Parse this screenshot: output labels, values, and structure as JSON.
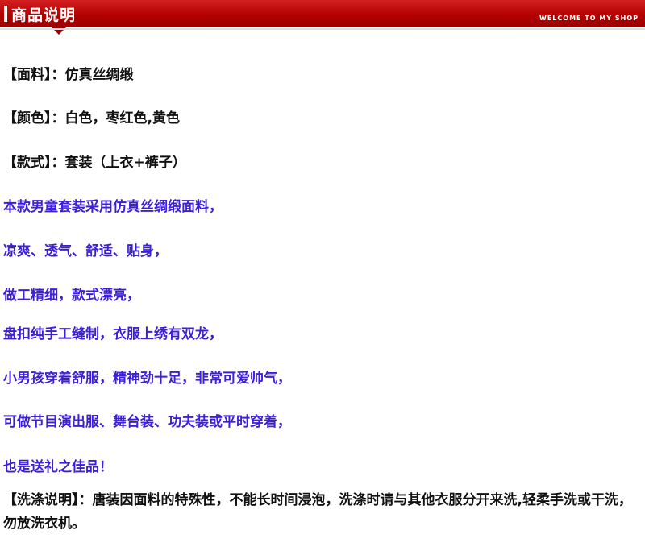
{
  "header": {
    "title": "商品说明",
    "tagline": "WELCOME TO MY SHOP"
  },
  "specs": {
    "fabric": "【面料】：仿真丝绸缎",
    "color": "【颜色】：白色，枣红色,黄色",
    "style": "【款式】：套装（上衣+裤子）"
  },
  "description": [
    "本款男童套装采用仿真丝绸缎面料，",
    "凉爽、透气、舒适、贴身，",
    "做工精细，款式漂亮，",
    "盘扣纯手工缝制，衣服上绣有双龙，",
    "小男孩穿着舒服，精神劲十足，非常可爱帅气，",
    "可做节目演出服、舞台装、功夫装或平时穿着，",
    "也是送礼之佳品！"
  ],
  "washing": "【洗涤说明】：唐装因面料的特殊性，不能长时间浸泡，洗涤时请与其他衣服分开来洗,轻柔手洗或干洗，勿放洗衣机。",
  "colors": {
    "header_red": "#b30000",
    "text_black": "#111111",
    "text_blue": "#3b1fd6"
  }
}
